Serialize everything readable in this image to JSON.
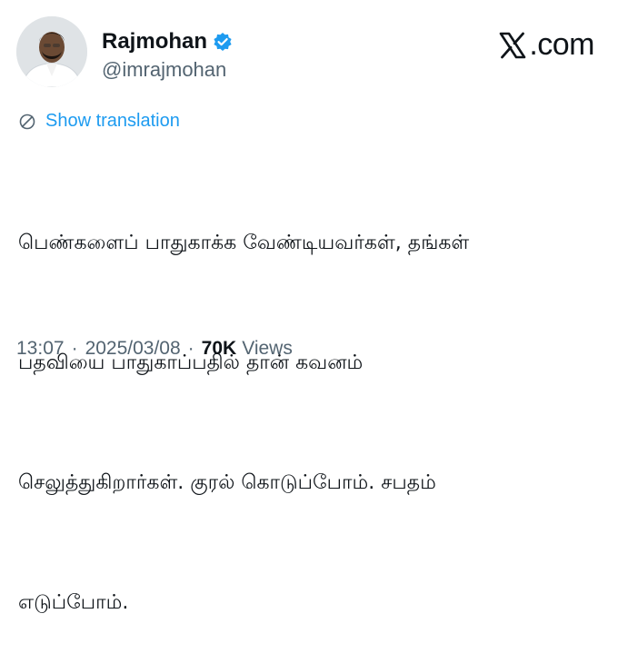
{
  "author": {
    "name": "Rajmohan",
    "handle": "@imrajmohan",
    "verified": true,
    "verified_color": "#1d9bf0"
  },
  "brand": {
    "label": ".com"
  },
  "translation": {
    "label": "Show translation",
    "icon": "globe-icon",
    "color": "#1d9bf0"
  },
  "tweet": {
    "lines": [
      "பெண்களைப் பாதுகாக்க வேண்டியவர்கள், தங்கள்",
      "பதவியை பாதுகாப்பதில் தான் கவனம்",
      "செலுத்துகிறார்கள். குரல் கொடுப்போம். சபதம்",
      "எடுப்போம்."
    ]
  },
  "meta": {
    "time": "13:07",
    "date": "2025/03/08",
    "views_count": "70K",
    "views_label": "Views",
    "separator": "·"
  }
}
